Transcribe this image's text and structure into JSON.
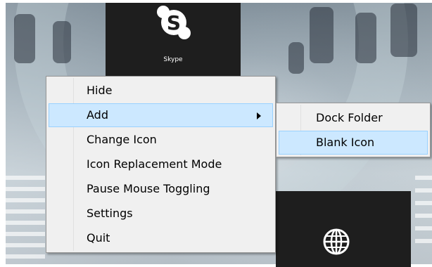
{
  "desktop": {
    "tiles": {
      "skype": {
        "label": "Skype",
        "icon": "skype-icon"
      },
      "web": {
        "icon": "globe-icon"
      }
    }
  },
  "context_menu": {
    "items": [
      {
        "label": "Hide"
      },
      {
        "label": "Add",
        "has_submenu": true,
        "highlighted": true
      },
      {
        "label": "Change Icon"
      },
      {
        "label": "Icon Replacement Mode"
      },
      {
        "label": "Pause Mouse Toggling"
      },
      {
        "label": "Settings"
      },
      {
        "label": "Quit"
      }
    ]
  },
  "submenu": {
    "items": [
      {
        "label": "Dock Folder"
      },
      {
        "label": "Blank Icon",
        "highlighted": true
      }
    ]
  },
  "colors": {
    "menu_background": "#f0f0f0",
    "menu_border": "#979797",
    "highlight_fill": "#cce8ff",
    "highlight_border": "#99d1ff",
    "tile_background": "#1e1e1e"
  }
}
